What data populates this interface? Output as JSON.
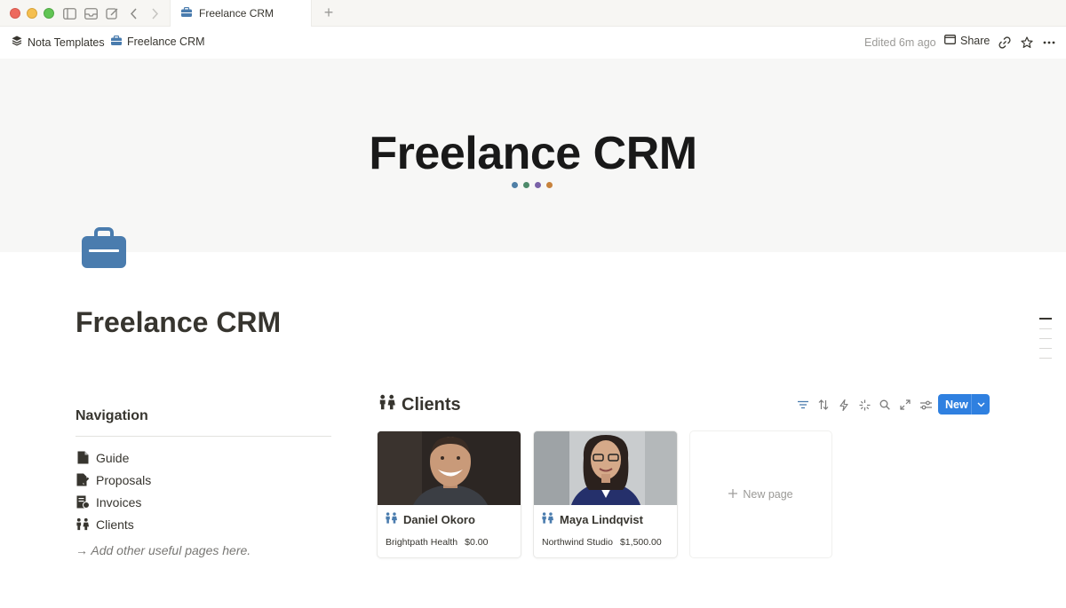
{
  "browser": {
    "tab_title": "Freelance CRM",
    "new_tab_glyph": "+"
  },
  "breadcrumb": {
    "workspace": "Nota Templates",
    "page": "Freelance CRM"
  },
  "topbar": {
    "edited": "Edited 6m ago",
    "share_label": "Share"
  },
  "cover": {
    "title": "Freelance CRM",
    "dot_colors": [
      "#4f7fa6",
      "#4d8a6a",
      "#7a62a8",
      "#c7823c"
    ]
  },
  "page": {
    "title": "Freelance CRM",
    "icon": "briefcase-icon",
    "icon_color": "#4a7cae"
  },
  "navigation": {
    "heading": "Navigation",
    "items": [
      {
        "label": "Guide",
        "icon": "document-icon"
      },
      {
        "label": "Proposals",
        "icon": "document-pen-icon"
      },
      {
        "label": "Invoices",
        "icon": "receipt-icon"
      },
      {
        "label": "Clients",
        "icon": "people-icon"
      }
    ],
    "hint": "→ Add other useful pages here."
  },
  "clients": {
    "title": "Clients",
    "new_label": "New",
    "new_page_label": "New page",
    "cards": [
      {
        "name": "Daniel Okoro",
        "company": "Brightpath Health",
        "amount": "$0.00"
      },
      {
        "name": "Maya Lindqvist",
        "company": "Northwind Studio",
        "amount": "$1,500.00"
      }
    ]
  },
  "colors": {
    "accent_blue": "#2f80e0",
    "toolbar_icon": "#7b96b3"
  }
}
